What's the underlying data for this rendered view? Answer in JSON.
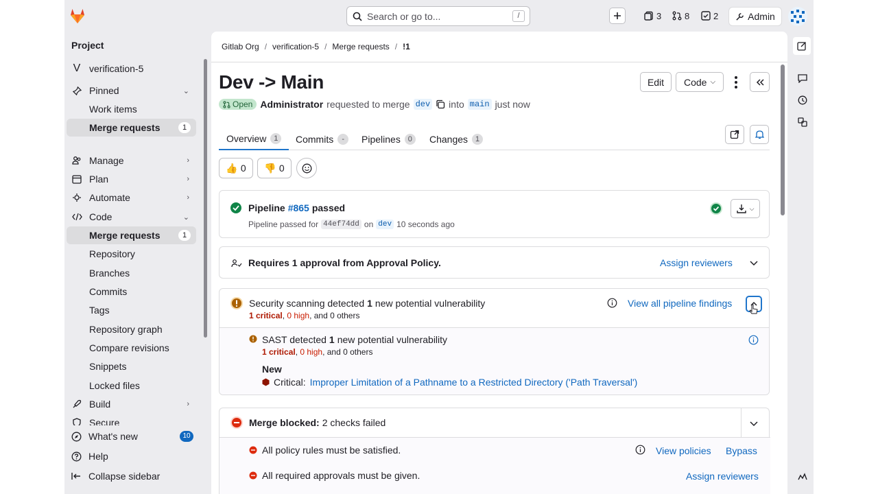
{
  "topbar": {
    "search_placeholder": "Search or go to...",
    "search_shortcut": "/",
    "issues_count": "3",
    "mr_count": "8",
    "todo_count": "2",
    "admin_label": "Admin"
  },
  "sidebar": {
    "title": "Project",
    "project_initial": "V",
    "project_name": "verification-5",
    "items": [
      {
        "label": "Pinned",
        "icon": "pin-icon"
      },
      {
        "label": "Work items"
      },
      {
        "label": "Merge requests",
        "badge": "1"
      },
      {
        "label": "Manage",
        "icon": "users-icon"
      },
      {
        "label": "Plan",
        "icon": "calendar-icon"
      },
      {
        "label": "Automate",
        "icon": "rocket-icon"
      },
      {
        "label": "Code",
        "icon": "code-icon"
      },
      {
        "label": "Merge requests",
        "badge": "1"
      },
      {
        "label": "Repository"
      },
      {
        "label": "Branches"
      },
      {
        "label": "Commits"
      },
      {
        "label": "Tags"
      },
      {
        "label": "Repository graph"
      },
      {
        "label": "Compare revisions"
      },
      {
        "label": "Snippets"
      },
      {
        "label": "Locked files"
      },
      {
        "label": "Build",
        "icon": "rocket-icon"
      },
      {
        "label": "Secure"
      }
    ],
    "footer": {
      "whats_new": "What's new",
      "whats_new_count": "10",
      "help": "Help",
      "collapse": "Collapse sidebar"
    }
  },
  "breadcrumb": [
    "Gitlab Org",
    "verification-5",
    "Merge requests",
    "!1"
  ],
  "mr": {
    "title": "Dev -> Main",
    "edit_label": "Edit",
    "code_label": "Code",
    "status": "Open",
    "author": "Administrator",
    "requested_text": "requested to merge",
    "source_branch": "dev",
    "into_text": "into",
    "target_branch": "main",
    "time": "just now"
  },
  "tabs": [
    {
      "label": "Overview",
      "count": "1"
    },
    {
      "label": "Commits",
      "count": "-"
    },
    {
      "label": "Pipelines",
      "count": "0"
    },
    {
      "label": "Changes",
      "count": "1"
    }
  ],
  "reactions": {
    "thumbsup": "0",
    "thumbsdown": "0"
  },
  "pipeline": {
    "prefix": "Pipeline",
    "id": "#865",
    "status_text": "passed",
    "sub_prefix": "Pipeline passed for",
    "sha": "44ef74dd",
    "on_text": "on",
    "branch": "dev",
    "time": "10 seconds ago"
  },
  "approval": {
    "text": "Requires 1 approval from Approval Policy.",
    "assign_label": "Assign reviewers"
  },
  "security": {
    "prefix": "Security scanning detected",
    "count": "1",
    "suffix": "new potential vulnerability",
    "critical": "1 critical",
    "high": "0 high",
    "others": ", and 0 others",
    "view_all_label": "View all pipeline findings",
    "sast_prefix": "SAST detected",
    "sast_count": "1",
    "sast_suffix": "new potential vulnerability",
    "sast_critical": "1 critical",
    "sast_high": "0 high",
    "sast_others": ", and 0 others",
    "new_label": "New",
    "finding_severity": "Critical:",
    "finding_title": "Improper Limitation of a Pathname to a Restricted Directory ('Path Traversal')"
  },
  "merge": {
    "blocked_label": "Merge blocked:",
    "blocked_text": "2 checks failed",
    "check1": "All policy rules must be satisfied.",
    "view_policies": "View policies",
    "bypass": "Bypass",
    "check2": "All required approvals must be given.",
    "assign_label": "Assign reviewers"
  },
  "colors": {
    "accent": "#1068bf",
    "success": "#108548",
    "danger": "#dd2b0e",
    "warning": "#ab6100"
  }
}
